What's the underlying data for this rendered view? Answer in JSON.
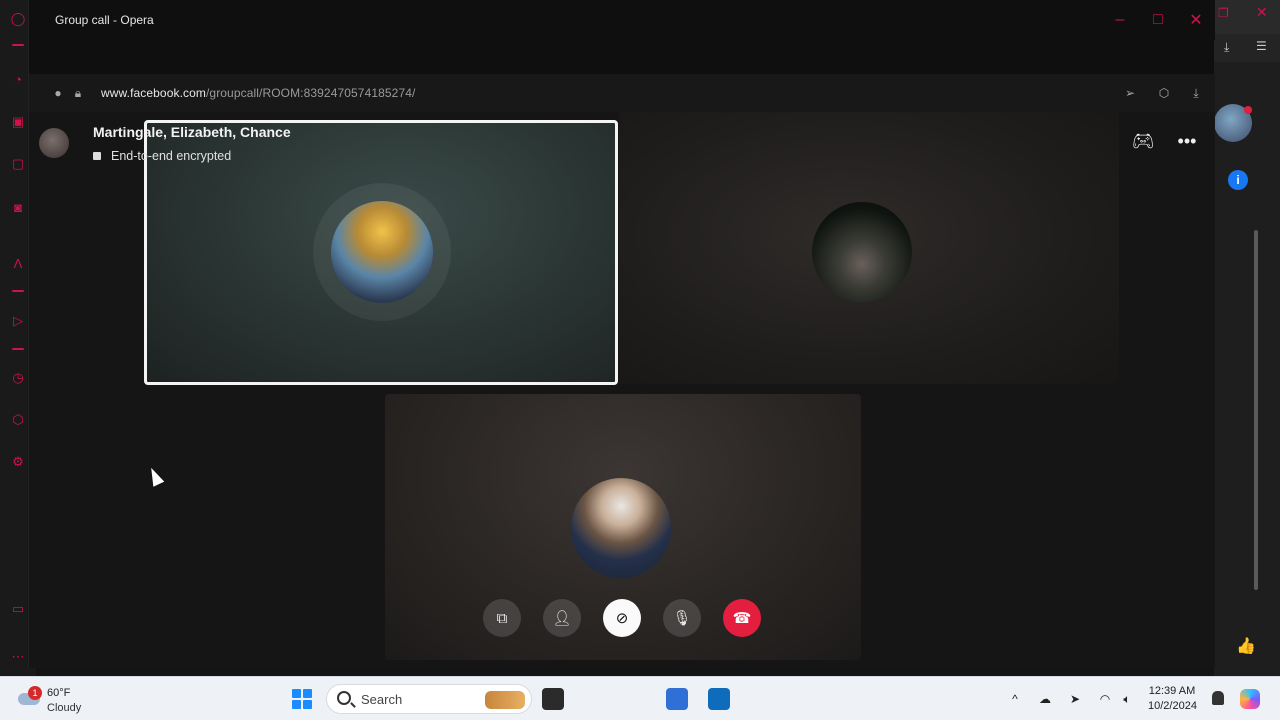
{
  "window": {
    "title": "Group call - Opera",
    "url": "www.facebook.com/groupcall/ROOM:8392470574185274/",
    "url_domain": "www.facebook.com",
    "url_path": "/groupcall/ROOM:8392470574185274/"
  },
  "call": {
    "participants_title": "Martingale, Elizabeth, Chance",
    "encryption_status": "End-to-end encrypted",
    "controls": [
      "share-screen",
      "add-people",
      "camera-off",
      "microphone",
      "end-call"
    ]
  },
  "taskbar": {
    "weather_temp": "60°F",
    "weather_condition": "Cloudy",
    "weather_badge": "1",
    "search_placeholder": "Search",
    "time": "12:39 AM",
    "date": "10/2/2024"
  },
  "colors": {
    "opera_accent": "#d0124a",
    "end_call": "#e41e3f",
    "facebook_blue": "#1877f2"
  }
}
